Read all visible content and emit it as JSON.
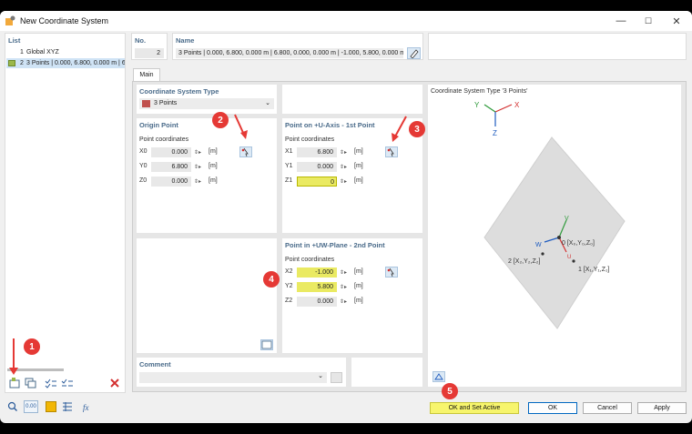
{
  "window": {
    "title": "New Coordinate System",
    "minimize": "—",
    "maximize": "☐",
    "close": "✕"
  },
  "list": {
    "header": "List",
    "items": [
      {
        "no": "1",
        "label": "Global XYZ"
      },
      {
        "no": "2",
        "label": "3 Points | 0.000, 6.800, 0.000 m | 6.8"
      }
    ]
  },
  "no": {
    "label": "No.",
    "value": "2"
  },
  "name": {
    "label": "Name",
    "value": "3 Points | 0.000, 6.800, 0.000 m | 6.800, 0.000, 0.000 m | -1.000, 5.800, 0.000 m"
  },
  "tabs": {
    "main": "Main"
  },
  "cs_type": {
    "header": "Coordinate System Type",
    "value": "3 Points",
    "swatch_color": "#c0504d"
  },
  "origin": {
    "header": "Origin Point",
    "subheader": "Point coordinates",
    "rows": [
      {
        "label": "X0",
        "value": "0.000",
        "unit": "[m]"
      },
      {
        "label": "Y0",
        "value": "6.800",
        "unit": "[m]"
      },
      {
        "label": "Z0",
        "value": "0.000",
        "unit": "[m]"
      }
    ]
  },
  "u_axis": {
    "header": "Point on +U-Axis - 1st Point",
    "subheader": "Point coordinates",
    "rows": [
      {
        "label": "X1",
        "value": "6.800",
        "unit": "[m]"
      },
      {
        "label": "Y1",
        "value": "0.000",
        "unit": "[m]"
      },
      {
        "label": "Z1",
        "value": "0",
        "unit": "[m]"
      }
    ]
  },
  "uw_plane": {
    "header": "Point in +UW-Plane - 2nd Point",
    "subheader": "Point coordinates",
    "rows": [
      {
        "label": "X2",
        "value": "-1.000",
        "unit": "[m]"
      },
      {
        "label": "Y2",
        "value": "5.800",
        "unit": "[m]"
      },
      {
        "label": "Z2",
        "value": "0.000",
        "unit": "[m]"
      }
    ]
  },
  "preview": {
    "title": "Coordinate System Type '3 Points'",
    "axis_x": "X",
    "axis_y": "Y",
    "axis_z": "Z",
    "local_v": "V",
    "local_w": "W",
    "local_u": "U",
    "p0": "0 [X₀,Y₀,Z₀]",
    "p1": "1 [X₁,Y₁,Z₁]",
    "p2": "2 [X₂,Y₂,Z₂]"
  },
  "comment": {
    "header": "Comment",
    "value": ""
  },
  "buttons": {
    "ok_active": "OK and Set Active",
    "ok": "OK",
    "cancel": "Cancel",
    "apply": "Apply"
  },
  "status": {
    "units_label": "0.00"
  },
  "annotations": {
    "b1": "1",
    "b2": "2",
    "b3": "3",
    "b4": "4",
    "b5": "5"
  },
  "colors": {
    "accent": "#0067c0",
    "highlight": "#eaea62",
    "arrow": "#e53935",
    "header": "#4a6b8a"
  }
}
